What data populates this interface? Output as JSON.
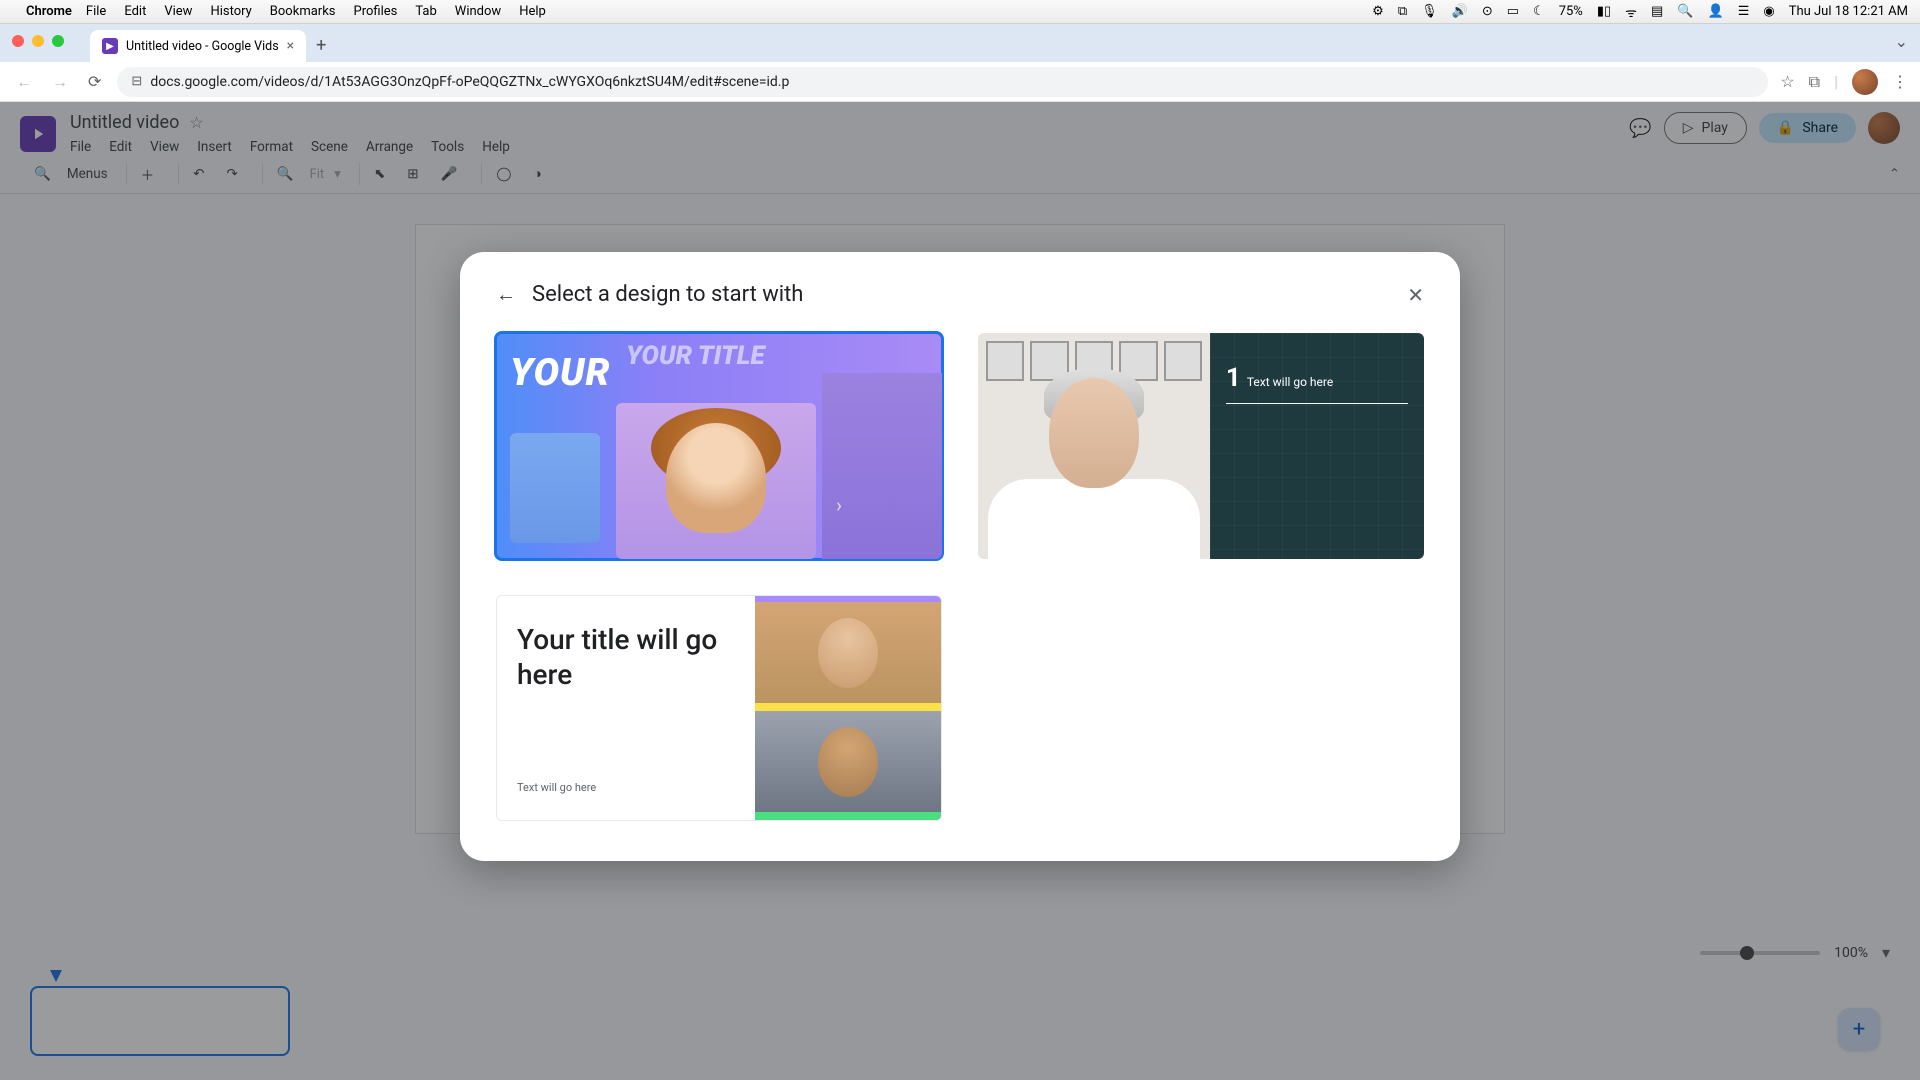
{
  "mac_menubar": {
    "app_name": "Chrome",
    "menus": [
      "File",
      "Edit",
      "View",
      "History",
      "Bookmarks",
      "Profiles",
      "Tab",
      "Window",
      "Help"
    ],
    "battery": "75%",
    "clock": "Thu Jul 18  12:21 AM"
  },
  "browser": {
    "tab_title": "Untitled video - Google Vids",
    "url": "docs.google.com/videos/d/1At53AGG3OnzQpFf-oPeQQGZTNx_cWYGXOq6nkztSU4M/edit#scene=id.p"
  },
  "app": {
    "doc_title": "Untitled video",
    "menus": [
      "File",
      "Edit",
      "View",
      "Insert",
      "Format",
      "Scene",
      "Arrange",
      "Tools",
      "Help"
    ],
    "toolbar": {
      "menus_label": "Menus",
      "zoom_placeholder": "Fit"
    },
    "play_label": "Play",
    "share_label": "Share",
    "zoom_label": "100%"
  },
  "modal": {
    "title": "Select a design to start with",
    "designs": {
      "card1_title_a": "YOUR",
      "card1_title_b": "YOUR TITLE",
      "card2_num": "1",
      "card2_text": "Text will go here",
      "card3_title": "Your title will go here",
      "card3_sub": "Text will go here"
    }
  }
}
